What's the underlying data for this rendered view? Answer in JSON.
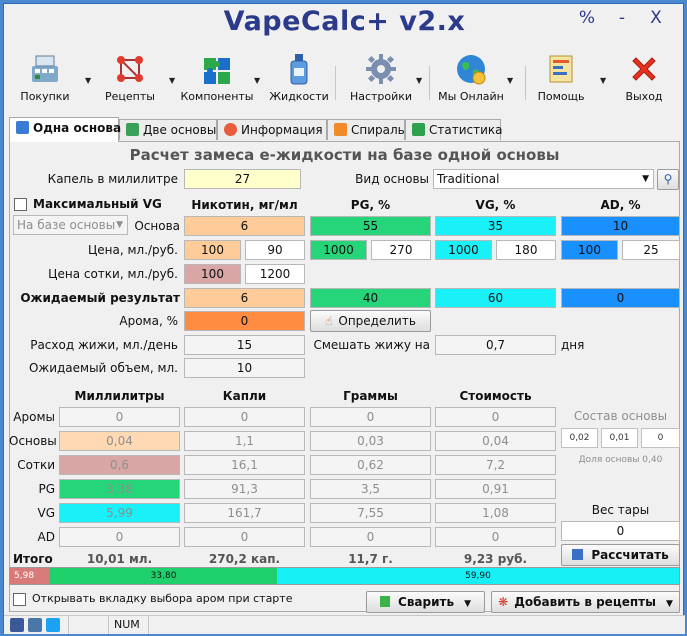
{
  "window": {
    "title": "VapeCalc+ v2.x",
    "btn_max": "%",
    "btn_min": "-",
    "btn_close": "X"
  },
  "toolbar": [
    {
      "label": "Покупки",
      "icon": "cash-register-icon"
    },
    {
      "label": "Рецепты",
      "icon": "molecule-icon"
    },
    {
      "label": "Компоненты",
      "icon": "puzzle-icon"
    },
    {
      "label": "Жидкости",
      "icon": "bottle-icon"
    },
    {
      "label": "Настройки",
      "icon": "gear-icon"
    },
    {
      "label": "Мы Онлайн",
      "icon": "globe-icon"
    },
    {
      "label": "Помощь",
      "icon": "help-book-icon"
    },
    {
      "label": "Выход",
      "icon": "exit-x-icon"
    }
  ],
  "tabs": [
    "Одна основа",
    "Две основы",
    "Информация",
    "Спираль",
    "Статистика"
  ],
  "heading": "Расчет замеса е-жидкости на базе одной основы",
  "drops_per_ml": {
    "label": "Капель в милилитре",
    "value": "27"
  },
  "base_type": {
    "label": "Вид основы",
    "value": "Traditional"
  },
  "max_vg": {
    "label": "Максимальный VG"
  },
  "base_select": {
    "value": "На базе основы"
  },
  "columns": {
    "nicotine": "Никотин, мг/мл",
    "pg": "PG, %",
    "vg": "VG, %",
    "ad": "AD, %"
  },
  "base_row": {
    "label": "Основа",
    "nicotine": "6",
    "pg": "55",
    "vg": "35",
    "ad": "10"
  },
  "price_row": {
    "label": "Цена, мл./руб.",
    "nic_ml": "100",
    "nic_rub": "90",
    "pg_ml": "1000",
    "pg_rub": "270",
    "vg_ml": "1000",
    "vg_rub": "180",
    "ad_ml": "100",
    "ad_rub": "25"
  },
  "hundred_row": {
    "label": "Цена сотки, мл./руб.",
    "ml": "100",
    "rub": "1200"
  },
  "result_row": {
    "label": "Ожидаемый результат",
    "nicotine": "6",
    "pg": "40",
    "vg": "60",
    "ad": "0"
  },
  "aroma_row": {
    "label": "Арома, %",
    "value": "0",
    "detect_button": "Определить"
  },
  "consumption_row": {
    "label": "Расход жижи, мл./день",
    "value": "15",
    "mix_label": "Смешать жижу на",
    "mix_value": "0,7",
    "days": "дня"
  },
  "volume_row": {
    "label": "Ожидаемый объем, мл.",
    "value": "10"
  },
  "table": {
    "headers": [
      "Миллилитры",
      "Капли",
      "Граммы",
      "Стоимость"
    ],
    "rows": [
      {
        "label": "Аромы",
        "ml": "0",
        "drops": "0",
        "grams": "0",
        "cost": "0"
      },
      {
        "label": "Основы",
        "ml": "0,04",
        "drops": "1,1",
        "grams": "0,03",
        "cost": "0,04"
      },
      {
        "label": "Сотки",
        "ml": "0,6",
        "drops": "16,1",
        "grams": "0,62",
        "cost": "7,2"
      },
      {
        "label": "PG",
        "ml": "3,38",
        "drops": "91,3",
        "grams": "3,5",
        "cost": "0,91"
      },
      {
        "label": "VG",
        "ml": "5,99",
        "drops": "161,7",
        "grams": "7,55",
        "cost": "1,08"
      },
      {
        "label": "AD",
        "ml": "0",
        "drops": "0",
        "grams": "0",
        "cost": "0"
      }
    ],
    "total": {
      "label": "Итого",
      "ml": "10,01 мл.",
      "drops": "270,2 кап.",
      "grams": "11,7 г.",
      "cost": "9,23 руб."
    }
  },
  "base_composition": {
    "label": "Состав основы",
    "values": [
      "0,02",
      "0,01",
      "0"
    ],
    "share_label": "Доля основы 0,40"
  },
  "tare": {
    "label": "Вес тары",
    "value": "0"
  },
  "calc_button": "Рассчитать",
  "progress": {
    "segments": [
      {
        "label": "5,98",
        "value": 5.98,
        "color": "#d97a7a"
      },
      {
        "label": "33,80",
        "value": 33.8,
        "color": "#1fd16d"
      },
      {
        "label": "59,90",
        "value": 59.9,
        "color": "#16f0f5"
      }
    ]
  },
  "open_aroma_checkbox": "Открывать вкладку выбора аром при старте",
  "brew_button": "Сварить",
  "add_recipe_button": "Добавить в рецепты",
  "status": {
    "num": "NUM"
  },
  "colors": {
    "nicotine": "#ffcc99",
    "pg": "#26d47a",
    "vg": "#19f0f7",
    "ad": "#1a90ff",
    "title": "#2b3a8a"
  }
}
